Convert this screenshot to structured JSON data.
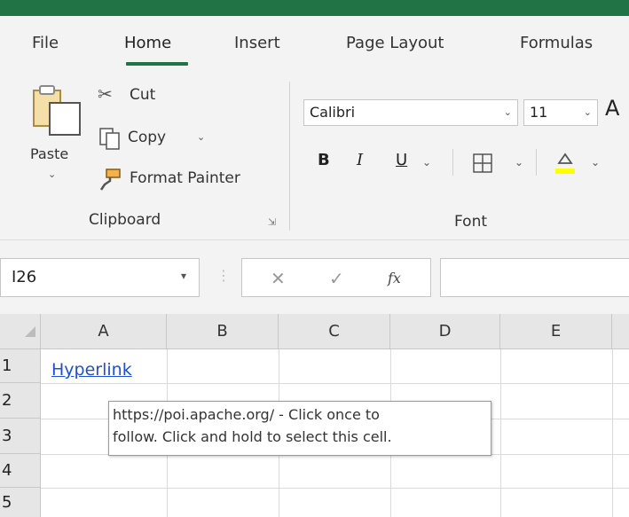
{
  "menu": {
    "tabs": [
      {
        "label": "File"
      },
      {
        "label": "Home"
      },
      {
        "label": "Insert"
      },
      {
        "label": "Page Layout"
      },
      {
        "label": "Formulas"
      }
    ]
  },
  "ribbon": {
    "clipboard": {
      "paste_label": "Paste",
      "cut_label": "Cut",
      "copy_label": "Copy",
      "format_painter_label": "Format Painter",
      "group_label": "Clipboard"
    },
    "font": {
      "font_name": "Calibri",
      "font_size": "11",
      "bold_label": "B",
      "italic_label": "I",
      "underline_label": "U",
      "group_label": "Font",
      "grow_label": "A",
      "fill_color": "#ffff00"
    }
  },
  "formula_bar": {
    "name_box": "I26",
    "fx_label": "fx",
    "value": ""
  },
  "grid": {
    "columns": [
      "A",
      "B",
      "C",
      "D",
      "E"
    ],
    "rows": [
      "1",
      "2",
      "3",
      "4",
      "5"
    ],
    "cell_A1": "Hyperlink",
    "tooltip_line1": "https://poi.apache.org/ - Click once to",
    "tooltip_line2": "follow. Click and hold to select this cell."
  },
  "colors": {
    "accent": "#217346",
    "link": "#1f4fd6"
  }
}
